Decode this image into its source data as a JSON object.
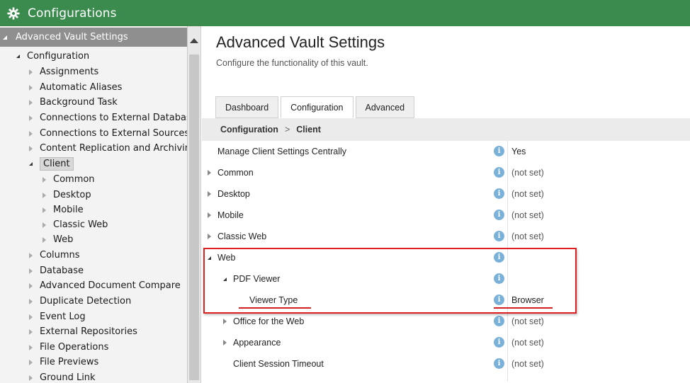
{
  "window": {
    "title": "Configurations",
    "icon": "gear-icon"
  },
  "tree": {
    "header": "Advanced Vault Settings",
    "root": "Configuration",
    "items": [
      "Assignments",
      "Automatic Aliases",
      "Background Task",
      "Connections to External Database",
      "Connections to External Sources",
      "Content Replication and Archiving",
      "Client",
      "Common",
      "Desktop",
      "Mobile",
      "Classic Web",
      "Web",
      "Columns",
      "Database",
      "Advanced Document Compare",
      "Duplicate Detection",
      "Event Log",
      "External Repositories",
      "File Operations",
      "File Previews",
      "Ground Link"
    ]
  },
  "main": {
    "title": "Advanced Vault Settings",
    "subtitle": "Configure the functionality of this vault.",
    "tabs": [
      "Dashboard",
      "Configuration",
      "Advanced"
    ],
    "breadcrumb": [
      "Configuration",
      ">",
      "Client"
    ],
    "rows": [
      {
        "label": "Manage Client Settings Centrally",
        "value": "Yes"
      },
      {
        "label": "Common",
        "value": "(not set)"
      },
      {
        "label": "Desktop",
        "value": "(not set)"
      },
      {
        "label": "Mobile",
        "value": "(not set)"
      },
      {
        "label": "Classic Web",
        "value": "(not set)"
      },
      {
        "label": "Web",
        "value": ""
      },
      {
        "label": "PDF Viewer",
        "value": ""
      },
      {
        "label": "Viewer Type",
        "value": "Browser"
      },
      {
        "label": "Office for the Web",
        "value": "(not set)"
      },
      {
        "label": "Appearance",
        "value": "(not set)"
      },
      {
        "label": "Client Session Timeout",
        "value": "(not set)"
      }
    ],
    "info_glyph": "i"
  },
  "colors": {
    "titlebar": "#3b8b4f",
    "highlight_box": "#e02020",
    "info_icon": "#7ab1d8"
  }
}
